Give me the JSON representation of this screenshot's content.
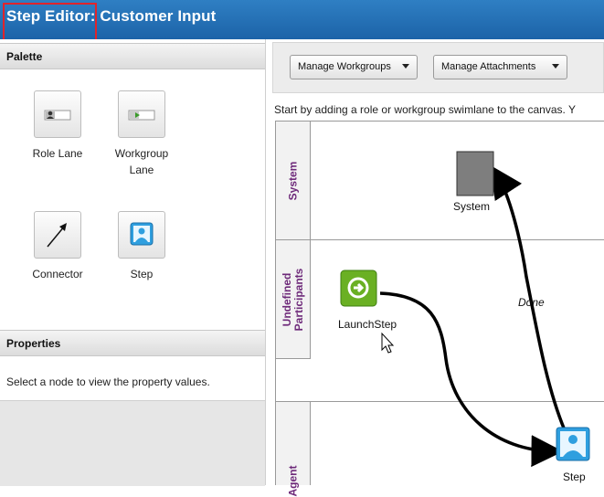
{
  "title": {
    "text": "Step Editor: Customer Input",
    "highlight_color": "#e0242b"
  },
  "palette": {
    "heading": "Palette",
    "items": [
      {
        "label": "Role Lane",
        "icon": "role-lane-icon"
      },
      {
        "label": "Workgroup Lane",
        "icon": "workgroup-lane-icon"
      },
      {
        "label": "Connector",
        "icon": "connector-icon"
      },
      {
        "label": "Step",
        "icon": "step-icon"
      }
    ]
  },
  "properties": {
    "heading": "Properties",
    "message": "Select a node to view the property values."
  },
  "toolbar": {
    "workgroups": "Manage Workgroups",
    "attachments": "Manage Attachments"
  },
  "canvas": {
    "hint": "Start by adding a role or workgroup swimlane to the canvas. Y",
    "lanes": [
      {
        "label": "System"
      },
      {
        "label_line1": "Undefined",
        "label_line2": "Participants"
      },
      {
        "label": "Agent"
      }
    ],
    "nodes": {
      "system": "System",
      "launch": "LaunchStep",
      "step": "Step"
    },
    "connector_label": "Done"
  },
  "colors": {
    "title_bar": "#1c63a8",
    "lane_label": "#6e2a7a",
    "launch_node": "#6ab023",
    "step_node": "#2f9fdf"
  }
}
